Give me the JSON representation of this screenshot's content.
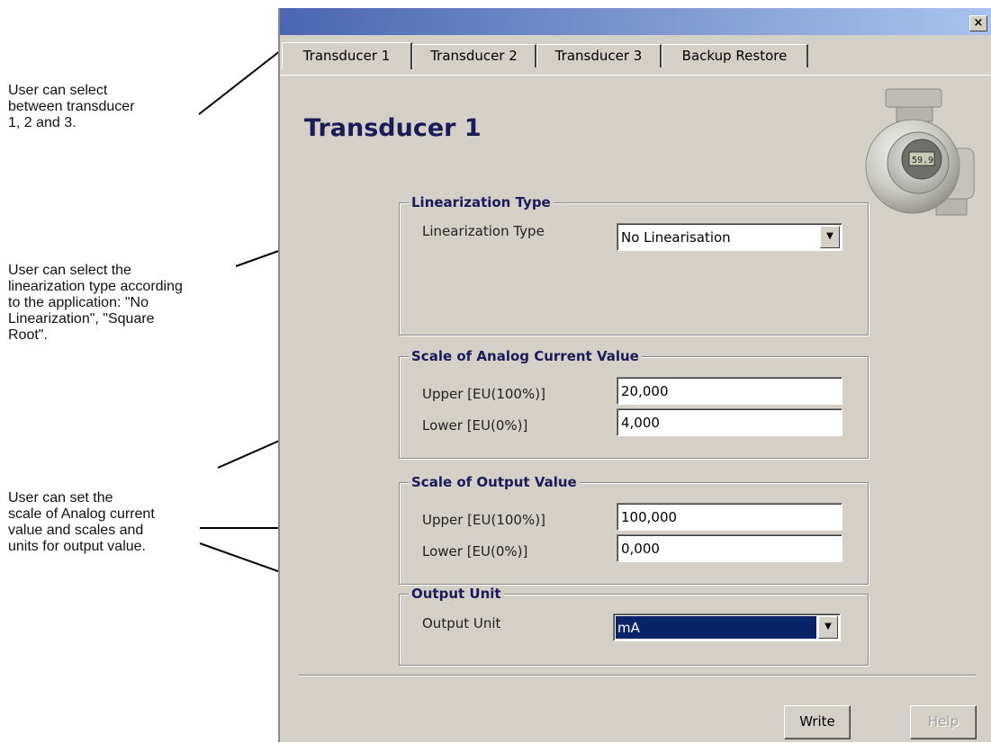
{
  "annotations": [
    "User can select\nbetween transducer\n1, 2 and 3.",
    "User can select the\nlinearization type according\nto the application: \"No\nLinearization\", \"Square\nRoot\".",
    "User can set the\nscale of Analog current\nvalue and scales and\nunits for output value."
  ],
  "window": {
    "close_label": "×",
    "tabs": [
      {
        "label": "Transducer 1",
        "active": true
      },
      {
        "label": "Transducer 2",
        "active": false
      },
      {
        "label": "Transducer 3",
        "active": false
      },
      {
        "label": "Backup Restore",
        "active": false
      }
    ],
    "page_title": "Transducer 1",
    "device_display": "59.9",
    "linearization": {
      "group_title": "Linearization Type",
      "label": "Linearization Type",
      "value": "No Linearisation"
    },
    "analog_scale": {
      "group_title": "Scale of Analog Current Value",
      "upper_label": "Upper [EU(100%)]",
      "upper_value": "20,000",
      "lower_label": "Lower [EU(0%)]",
      "lower_value": "4,000"
    },
    "output_scale": {
      "group_title": "Scale of Output Value",
      "upper_label": "Upper [EU(100%)]",
      "upper_value": "100,000",
      "lower_label": "Lower [EU(0%)]",
      "lower_value": "0,000"
    },
    "output_unit": {
      "group_title": "Output Unit",
      "label": "Output Unit",
      "value": "mA"
    },
    "buttons": {
      "write": "Write",
      "help": "Help"
    }
  },
  "colors": {
    "window_bg": "#d4d0c8",
    "title_text": "#1b1b5a",
    "selection": "#0a246a"
  }
}
